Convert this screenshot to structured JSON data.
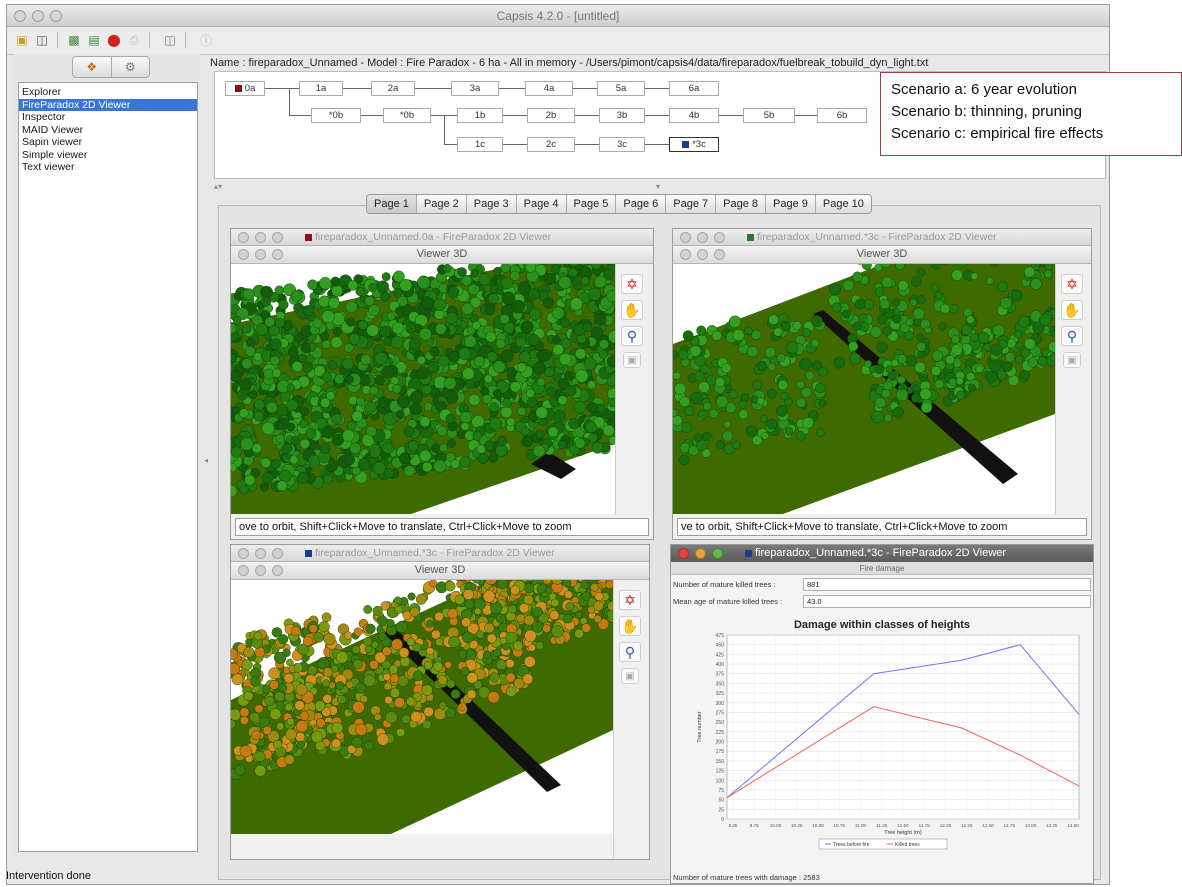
{
  "window": {
    "title": "Capsis 4.2.0 - [untitled]"
  },
  "tool_list": {
    "items": [
      {
        "label": "Explorer",
        "selected": false
      },
      {
        "label": "FireParadox 2D Viewer",
        "selected": true
      },
      {
        "label": "Inspector",
        "selected": false
      },
      {
        "label": "MAID Viewer",
        "selected": false
      },
      {
        "label": "Sapin viewer",
        "selected": false
      },
      {
        "label": "Simple viewer",
        "selected": false
      },
      {
        "label": "Text viewer",
        "selected": false
      }
    ]
  },
  "project": {
    "name_line": "Name : fireparadox_Unnamed - Model : Fire Paradox - 6 ha - All in memory - /Users/pimont/capsis4/data/fireparadox/fuelbreak_tobuild_dyn_light.txt"
  },
  "tree": {
    "row_a": [
      "0a",
      "1a",
      "2a",
      "3a",
      "4a",
      "5a",
      "6a"
    ],
    "row_b": [
      "*0b",
      "*0b",
      "1b",
      "2b",
      "3b",
      "4b",
      "5b",
      "6b"
    ],
    "row_c": [
      "1c",
      "2c",
      "3c",
      "*3c"
    ],
    "colors": {
      "root_mark": "#8b1010",
      "current_mark": "#1a3a8a"
    }
  },
  "annotation": {
    "lines": [
      "Scenario a: 6 year evolution",
      "Scenario b: thinning, pruning",
      "Scenario c: empirical fire effects"
    ]
  },
  "pages": {
    "tabs": [
      "Page 1",
      "Page 2",
      "Page 3",
      "Page 4",
      "Page 5",
      "Page 6",
      "Page 7",
      "Page 8",
      "Page 9",
      "Page 10"
    ],
    "selected": "Page 1"
  },
  "viewers": {
    "tl": {
      "outer_title": "fireparadox_Unnamed.0a - FireParadox 2D Viewer",
      "inner_title": "Viewer 3D",
      "status": "ove to orbit, Shift+Click+Move to translate, Ctrl+Click+Move to zoom",
      "mark_color": "#8b1010"
    },
    "tr": {
      "outer_title": "fireparadox_Unnamed.*3c - FireParadox 2D Viewer",
      "inner_title": "Viewer 3D",
      "status": "ve to orbit, Shift+Click+Move to translate, Ctrl+Click+Move to zoom",
      "mark_color": "#2a7a2a"
    },
    "bl": {
      "outer_title": "fireparadox_Unnamed.*3c - FireParadox 2D Viewer",
      "inner_title": "Viewer 3D",
      "mark_color": "#1a3a8a"
    }
  },
  "fire_damage": {
    "window_title": "fireparadox_Unnamed.*3c - FireParadox 2D Viewer",
    "panel_title": "Fire damage",
    "killed_label": "Number of mature killed trees :",
    "killed_value": "881",
    "age_label": "Mean age of mature killed trees :",
    "age_value": "43.0",
    "damaged_label": "Number of mature trees with damage :",
    "damaged_value": "2583",
    "mark_color": "#1a3a8a"
  },
  "chart_data": {
    "type": "line",
    "title": "Damage within classes of heights",
    "xlabel": "Tree height (m)",
    "ylabel": "Tree number",
    "x": [
      8.0,
      10.5,
      12.0,
      13.0,
      14.0
    ],
    "x_ticks": [
      "8.25",
      "8.75",
      "10.00",
      "10.25",
      "10.50",
      "10.75",
      "11.00",
      "11.25",
      "11.50",
      "11.75",
      "12.00",
      "12.25",
      "12.50",
      "12.75",
      "13.00",
      "13.25",
      "13.50"
    ],
    "ylim": [
      0,
      475
    ],
    "y_ticks": [
      0,
      25,
      50,
      75,
      100,
      125,
      150,
      175,
      200,
      225,
      250,
      275,
      300,
      325,
      350,
      375,
      400,
      425,
      450,
      475
    ],
    "series": [
      {
        "name": "Trees before fire",
        "color": "#7070ff",
        "values": [
          55,
          375,
          410,
          450,
          270
        ]
      },
      {
        "name": "Killed trees",
        "color": "#ff6060",
        "values": [
          55,
          290,
          235,
          165,
          85
        ]
      }
    ],
    "grid": true,
    "legend": "bottom"
  },
  "status_bar": {
    "text": "Intervention done"
  }
}
